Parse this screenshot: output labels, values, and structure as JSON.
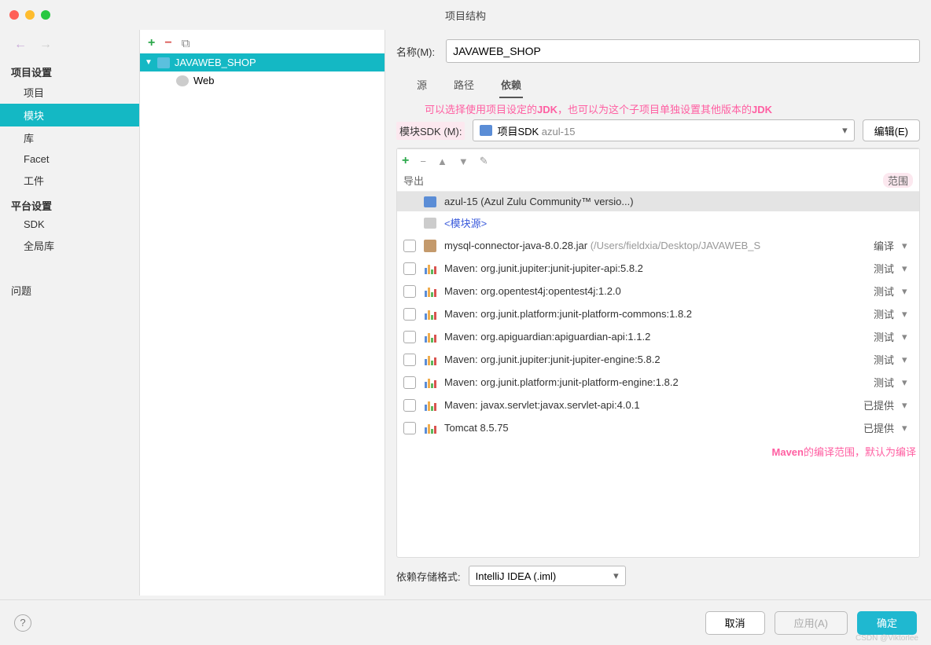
{
  "window_title": "项目结构",
  "sidebar": {
    "section1_header": "项目设置",
    "items1": [
      "项目",
      "模块",
      "库",
      "Facet",
      "工件"
    ],
    "section2_header": "平台设置",
    "items2": [
      "SDK",
      "全局库"
    ],
    "problems": "问题"
  },
  "tree": {
    "root": "JAVAWEB_SHOP",
    "child": "Web"
  },
  "content": {
    "name_label": "名称(M):",
    "name_value": "JAVAWEB_SHOP",
    "tabs": [
      "源",
      "路径",
      "依赖"
    ],
    "annotation1_a": "可以选择使用项目设定的",
    "annotation1_b": "JDK",
    "annotation1_c": "，也可以为这个子项目单独设置其他版本的",
    "annotation1_d": "JDK",
    "sdk_label": "模块SDK (M):",
    "sdk_value_a": "项目SDK",
    "sdk_value_b": " azul-15",
    "edit_btn": "编辑(E)",
    "export_header": "导出",
    "scope_header": "范围",
    "deps": [
      {
        "selected": true,
        "check": false,
        "icon": "folder",
        "name": "azul-15 (Azul Zulu Community™ versio...)",
        "scope": "",
        "caret": false
      },
      {
        "check": false,
        "icon": "folder-gray",
        "name": "<模块源>",
        "link": true,
        "scope": "",
        "caret": false
      },
      {
        "check": true,
        "icon": "jar",
        "name": "mysql-connector-java-8.0.28.jar",
        "suffix": " (/Users/fieldxia/Desktop/JAVAWEB_S",
        "scope": "编译",
        "caret": true
      },
      {
        "check": true,
        "icon": "lib",
        "name": "Maven: org.junit.jupiter:junit-jupiter-api:5.8.2",
        "scope": "测试",
        "caret": true
      },
      {
        "check": true,
        "icon": "lib",
        "name": "Maven: org.opentest4j:opentest4j:1.2.0",
        "scope": "测试",
        "caret": true
      },
      {
        "check": true,
        "icon": "lib",
        "name": "Maven: org.junit.platform:junit-platform-commons:1.8.2",
        "scope": "测试",
        "caret": true
      },
      {
        "check": true,
        "icon": "lib",
        "name": "Maven: org.apiguardian:apiguardian-api:1.1.2",
        "scope": "测试",
        "caret": true
      },
      {
        "check": true,
        "icon": "lib",
        "name": "Maven: org.junit.jupiter:junit-jupiter-engine:5.8.2",
        "scope": "测试",
        "caret": true
      },
      {
        "check": true,
        "icon": "lib",
        "name": "Maven: org.junit.platform:junit-platform-engine:1.8.2",
        "scope": "测试",
        "caret": true
      },
      {
        "check": true,
        "icon": "lib",
        "name": "Maven: javax.servlet:javax.servlet-api:4.0.1",
        "scope": "已提供",
        "caret": true
      },
      {
        "check": true,
        "icon": "lib",
        "name": "Tomcat 8.5.75",
        "scope": "已提供",
        "caret": true
      }
    ],
    "annotation2_a": "Maven",
    "annotation2_b": "的编译范围，默认为编译",
    "storage_label": "依赖存储格式:",
    "storage_value": "IntelliJ IDEA (.iml)"
  },
  "footer": {
    "cancel": "取消",
    "apply": "应用(A)",
    "ok": "确定"
  },
  "watermark": "CSDN @Viktorlee"
}
